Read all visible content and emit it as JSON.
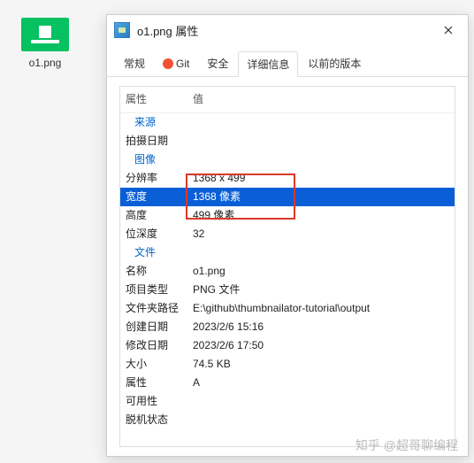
{
  "desktop": {
    "filename": "o1.png"
  },
  "dialog": {
    "title": "o1.png 属性",
    "tabs": {
      "general": "常规",
      "git": "Git",
      "security": "安全",
      "details": "详细信息",
      "previous": "以前的版本"
    },
    "header": {
      "prop": "属性",
      "val": "值"
    },
    "sections": {
      "source": "来源",
      "image": "图像",
      "file": "文件"
    },
    "rows": {
      "date_taken": {
        "label": "拍摄日期",
        "value": ""
      },
      "resolution": {
        "label": "分辨率",
        "value": "1368 x 499"
      },
      "width": {
        "label": "宽度",
        "value": "1368 像素"
      },
      "height": {
        "label": "高度",
        "value": "499 像素"
      },
      "bitdepth": {
        "label": "位深度",
        "value": "32"
      },
      "name": {
        "label": "名称",
        "value": "o1.png"
      },
      "itemtype": {
        "label": "项目类型",
        "value": "PNG 文件"
      },
      "folder": {
        "label": "文件夹路径",
        "value": "E:\\github\\thumbnailator-tutorial\\output"
      },
      "created": {
        "label": "创建日期",
        "value": "2023/2/6 15:16"
      },
      "modified": {
        "label": "修改日期",
        "value": "2023/2/6 17:50"
      },
      "size": {
        "label": "大小",
        "value": "74.5 KB"
      },
      "attrs": {
        "label": "属性",
        "value": "A"
      },
      "avail": {
        "label": "可用性",
        "value": ""
      },
      "offline": {
        "label": "脱机状态",
        "value": ""
      }
    }
  },
  "watermark": "知乎 @超哥聊编程"
}
